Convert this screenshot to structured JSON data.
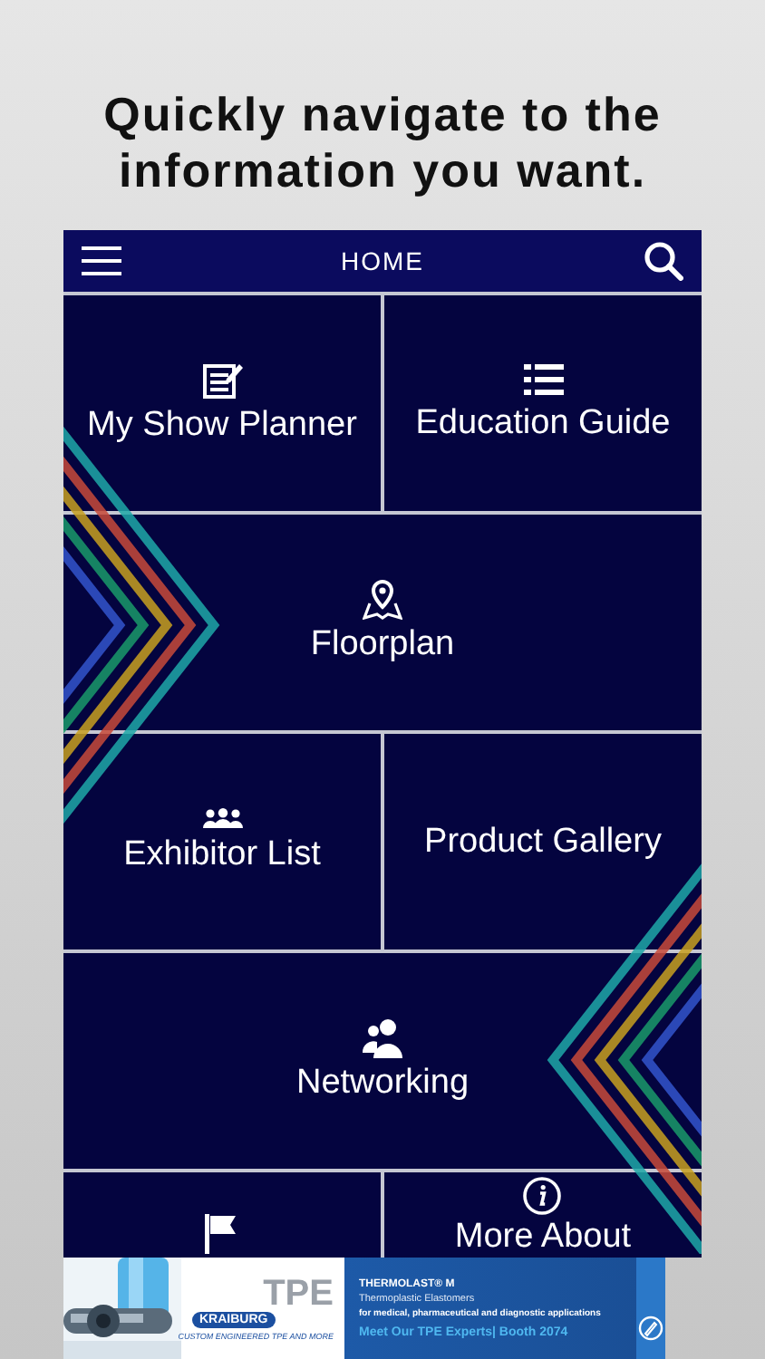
{
  "headline": "Quickly navigate to the information you want.",
  "header": {
    "title": "HOME"
  },
  "tiles": [
    [
      {
        "label": "My Show Planner",
        "kind": "planner"
      },
      {
        "label": "Education Guide",
        "kind": "list"
      }
    ],
    [
      {
        "label": "Floorplan",
        "kind": "map"
      }
    ],
    [
      {
        "label": "Exhibitor List",
        "kind": "group"
      },
      {
        "label": "Product Gallery",
        "kind": "plain"
      }
    ],
    [
      {
        "label": "Networking",
        "kind": "people"
      }
    ],
    [
      {
        "kind": "flag"
      },
      {
        "label": "More About",
        "kind": "info"
      }
    ]
  ],
  "ad": {
    "logo_big": "TPE",
    "logo_name": "KRAIBURG",
    "tagline": "CUSTOM ENGINEERED TPE AND MORE",
    "product": "THERMOLAST® M",
    "subtitle": "Thermoplastic Elastomers",
    "detail": "for medical, pharmaceutical and diagnostic applications",
    "cta": "Meet Our TPE Experts| Booth 2074"
  }
}
